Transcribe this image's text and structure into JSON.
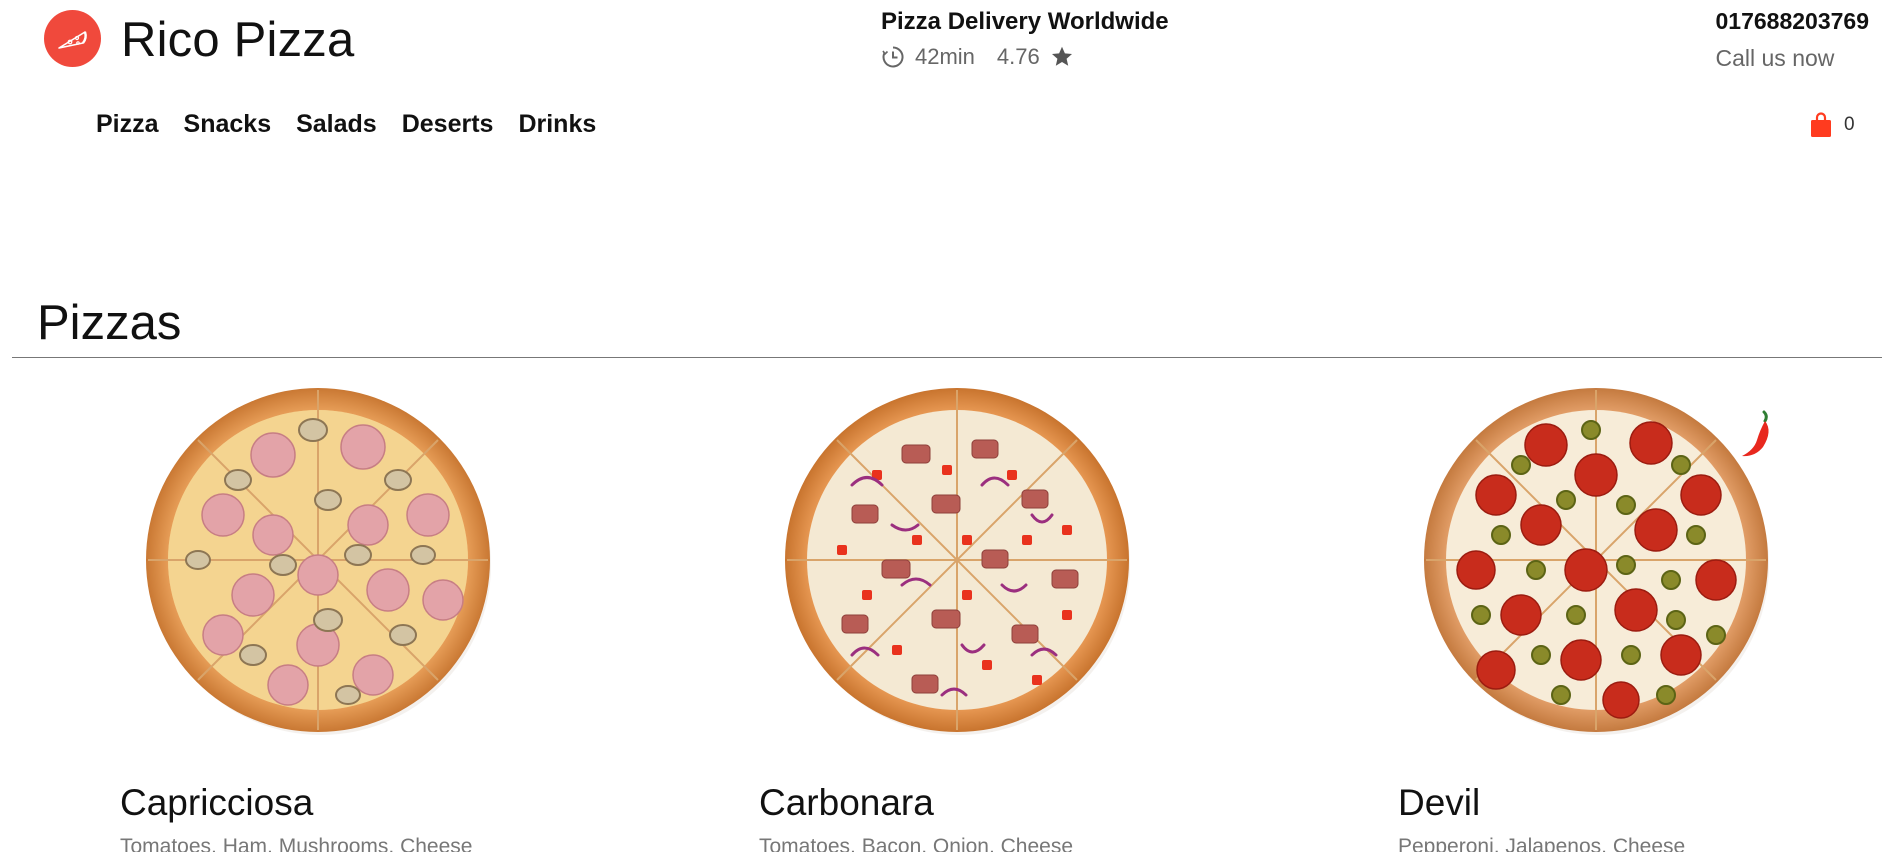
{
  "header": {
    "brand": "Rico Pizza",
    "delivery_title": "Pizza Delivery Worldwide",
    "delivery_time": "42min",
    "rating": "4.76",
    "phone": "017688203769",
    "call_label": "Call us now"
  },
  "nav": {
    "items": [
      {
        "label": "Pizza"
      },
      {
        "label": "Snacks"
      },
      {
        "label": "Salads"
      },
      {
        "label": "Deserts"
      },
      {
        "label": "Drinks"
      }
    ]
  },
  "cart": {
    "count": "0",
    "icon": "shopping-bag-icon"
  },
  "section": {
    "title": "Pizzas"
  },
  "products": [
    {
      "name": "Capricciosa",
      "description": "Tomatoes, Ham, Mushrooms, Cheese",
      "spicy": false
    },
    {
      "name": "Carbonara",
      "description": "Tomatoes, Bacon, Onion, Cheese",
      "spicy": false
    },
    {
      "name": "Devil",
      "description": "Pepperoni, Jalapenos, Cheese",
      "spicy": true
    }
  ],
  "colors": {
    "accent": "#f0493c",
    "cart": "#ff3b1f",
    "chili": "#e8281e"
  }
}
